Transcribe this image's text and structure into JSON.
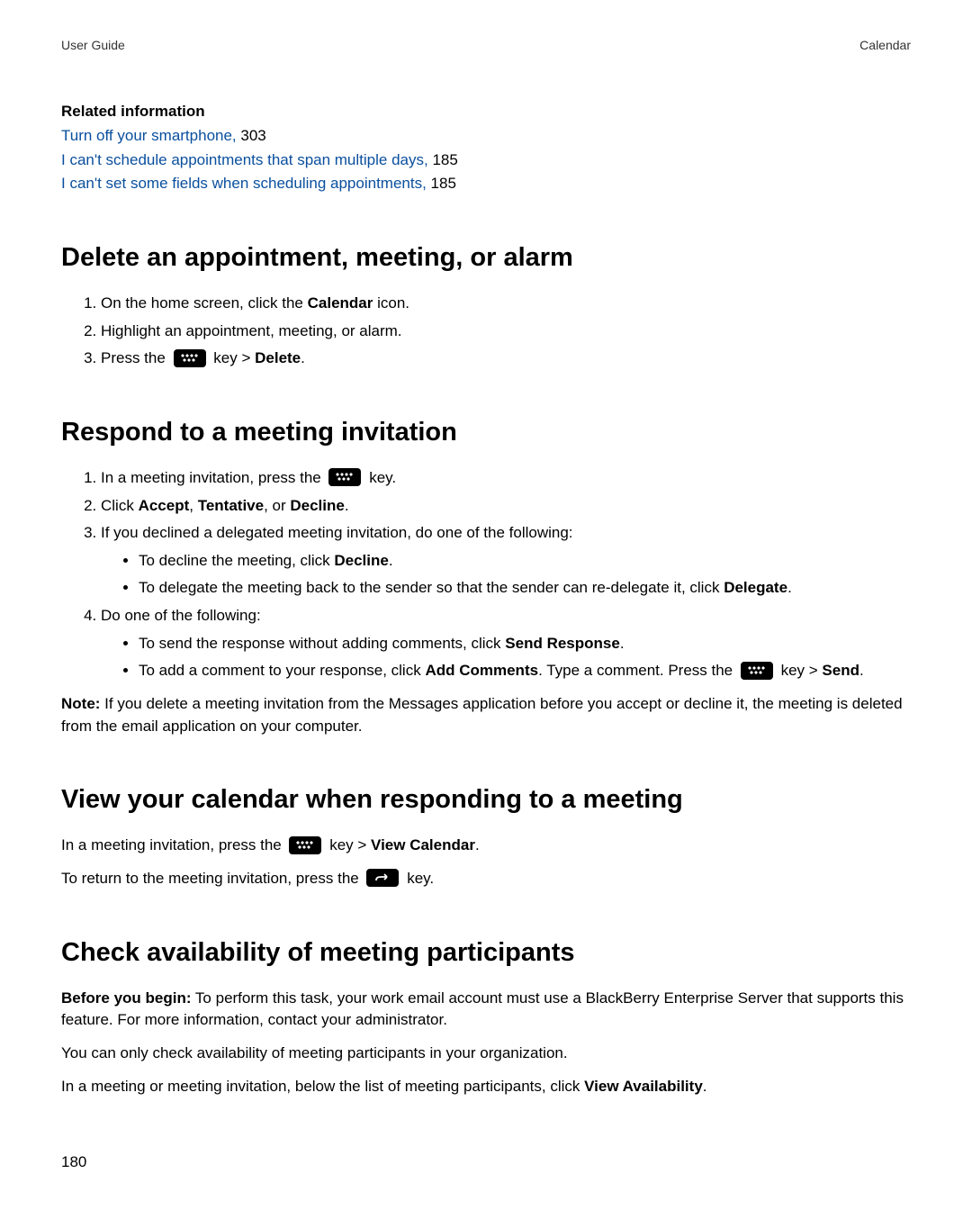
{
  "header": {
    "left": "User Guide",
    "right": "Calendar"
  },
  "related": {
    "heading": "Related information",
    "items": [
      {
        "link": "Turn off your smartphone,",
        "page": " 303"
      },
      {
        "link": "I can't schedule appointments that span multiple days,",
        "page": " 185"
      },
      {
        "link": "I can't set some fields when scheduling appointments,",
        "page": " 185"
      }
    ]
  },
  "section1": {
    "title": "Delete an appointment, meeting, or alarm",
    "step1a": "On the home screen, click the ",
    "step1b": "Calendar",
    "step1c": " icon.",
    "step2": "Highlight an appointment, meeting, or alarm.",
    "step3a": "Press the ",
    "step3b": " key > ",
    "step3c": "Delete",
    "step3d": "."
  },
  "section2": {
    "title": "Respond to a meeting invitation",
    "step1a": "In a meeting invitation, press the ",
    "step1b": " key.",
    "step2a": "Click ",
    "step2b": "Accept",
    "step2c": ", ",
    "step2d": "Tentative",
    "step2e": ", or ",
    "step2f": "Decline",
    "step2g": ".",
    "step3": "If you declined a delegated meeting invitation, do one of the following:",
    "step3_b1a": "To decline the meeting, click ",
    "step3_b1b": "Decline",
    "step3_b1c": ".",
    "step3_b2a": "To delegate the meeting back to the sender so that the sender can re-delegate it, click ",
    "step3_b2b": "Delegate",
    "step3_b2c": ".",
    "step4": "Do one of the following:",
    "step4_b1a": "To send the response without adding comments, click ",
    "step4_b1b": "Send Response",
    "step4_b1c": ".",
    "step4_b2a": "To add a comment to your response, click ",
    "step4_b2b": "Add Comments",
    "step4_b2c": ". Type a comment. Press the ",
    "step4_b2d": " key > ",
    "step4_b2e": "Send",
    "step4_b2f": ".",
    "note_label": "Note:",
    "note_text": " If you delete a meeting invitation from the Messages application before you accept or decline it, the meeting is deleted from the email application on your computer."
  },
  "section3": {
    "title": "View your calendar when responding to a meeting",
    "p1a": "In a meeting invitation, press the ",
    "p1b": " key > ",
    "p1c": "View Calendar",
    "p1d": ".",
    "p2a": "To return to the meeting invitation, press the ",
    "p2b": " key."
  },
  "section4": {
    "title": "Check availability of meeting participants",
    "p1_label": "Before you begin:",
    "p1_text": " To perform this task, your work email account must use a BlackBerry Enterprise Server that supports this feature. For more information, contact your administrator.",
    "p2": "You can only check availability of meeting participants in your organization.",
    "p3a": "In a meeting or meeting invitation, below the list of meeting participants, click ",
    "p3b": "View Availability",
    "p3c": "."
  },
  "page_number": "180"
}
